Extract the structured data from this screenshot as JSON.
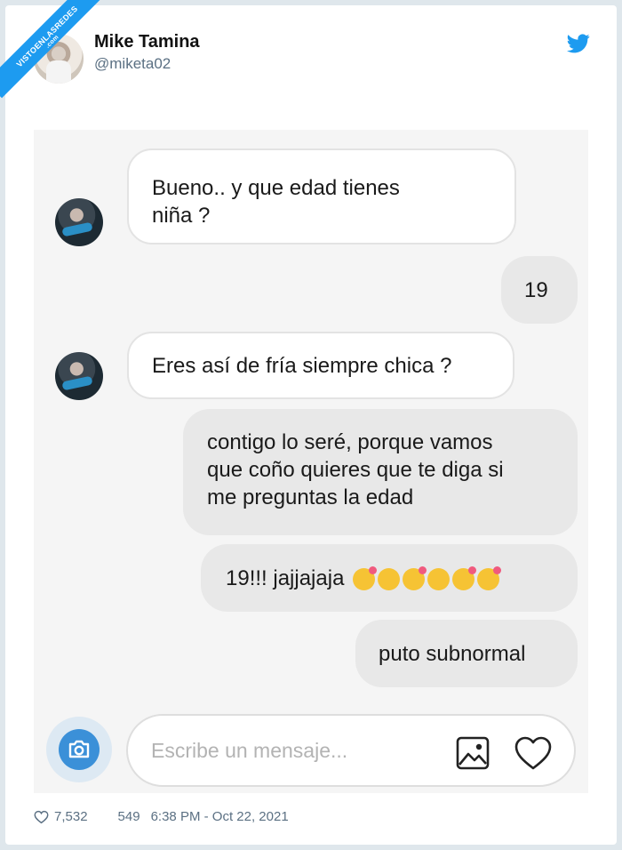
{
  "watermark": {
    "text": "VISTOENLASREDES",
    "subtext": ".com"
  },
  "tweet": {
    "author_name": "Mike Tamina",
    "author_handle": "@miketa02",
    "likes": "7,532",
    "retweets": "549",
    "timestamp": "6:38 PM - Oct 22, 2021"
  },
  "chat": {
    "messages": [
      {
        "side": "incoming",
        "lines": [
          "Bueno.. y que edad tienes",
          "niña ?"
        ]
      },
      {
        "side": "outgoing",
        "lines": [
          "19"
        ]
      },
      {
        "side": "incoming",
        "lines": [
          "Eres así de fría siempre chica ?"
        ]
      },
      {
        "side": "outgoing",
        "lines": [
          "contigo lo seré, porque vamos",
          "que coño quieres que te diga si",
          "me preguntas la edad"
        ]
      },
      {
        "side": "outgoing",
        "lines": [
          "19!!! jajjajaja"
        ],
        "emojis": [
          "kiss-heart-emoji",
          "wink-emoji",
          "kiss-heart-emoji",
          "wink-emoji",
          "kiss-heart-emoji",
          "heart-eyes-emoji"
        ]
      },
      {
        "side": "outgoing",
        "lines": [
          "puto subnormal"
        ]
      }
    ],
    "input_placeholder": "Escribe un mensaje..."
  },
  "icons": {
    "twitter": "twitter-bird-icon",
    "camera": "camera-icon",
    "gallery": "image-gallery-icon",
    "heart": "heart-icon",
    "like": "like-heart-icon"
  },
  "colors": {
    "twitter_blue": "#1d9bf0",
    "camera_blue": "#3b90d8",
    "outgoing_bubble": "#e8e8e8",
    "chat_background": "#f5f5f5"
  }
}
